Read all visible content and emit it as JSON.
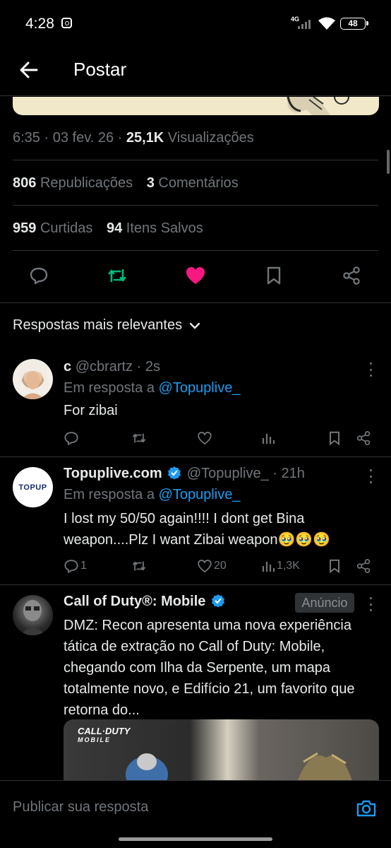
{
  "status_bar": {
    "time": "4:28",
    "network": "4G",
    "battery": "48"
  },
  "header": {
    "title": "Postar"
  },
  "post": {
    "time": "6:35",
    "date": "03 fev. 26",
    "views_count": "25,1K",
    "views_label": "Visualizações",
    "reposts_count": "806",
    "reposts_label": "Republicações",
    "comments_count": "3",
    "comments_label": "Comentários",
    "likes_count": "959",
    "likes_label": "Curtidas",
    "saves_count": "94",
    "saves_label": "Itens Salvos"
  },
  "colors": {
    "repost_active": "#00ba7c",
    "like_active": "#f91880",
    "link": "#1d9bf0",
    "muted": "#71767b"
  },
  "replies_header": "Respostas mais relevantes",
  "replies": [
    {
      "name": "c",
      "handle": "@cbrartz",
      "time": "2s",
      "in_reply_prefix": "Em resposta a",
      "in_reply_to": "@Topuplive_",
      "text": "For zibai",
      "reply_count": "",
      "like_count": "",
      "view_count": ""
    },
    {
      "name": "Topuplive.com",
      "handle": "@Topuplive_",
      "time": "21h",
      "in_reply_prefix": "Em resposta a",
      "in_reply_to": "@Topuplive_",
      "text": "I lost my 50/50 again!!!! I dont get Bina weapon....Plz I want Zibai weapon🥹🥹🥹",
      "reply_count": "1",
      "like_count": "20",
      "view_count": "1,3K",
      "avatar_text": "TOPUP"
    }
  ],
  "ad": {
    "name": "Call of Duty®: Mobile",
    "badge": "Anúncio",
    "text": "DMZ: Recon apresenta uma nova experiência tática de extração no Call of Duty: Mobile, chegando com Ilha da Serpente, um mapa totalmente novo, e Edifício 21, um favorito que retorna do...",
    "media_logo_line1": "CALL·DUTY",
    "media_logo_line2": "MOBILE"
  },
  "composer": {
    "placeholder": "Publicar sua resposta"
  }
}
